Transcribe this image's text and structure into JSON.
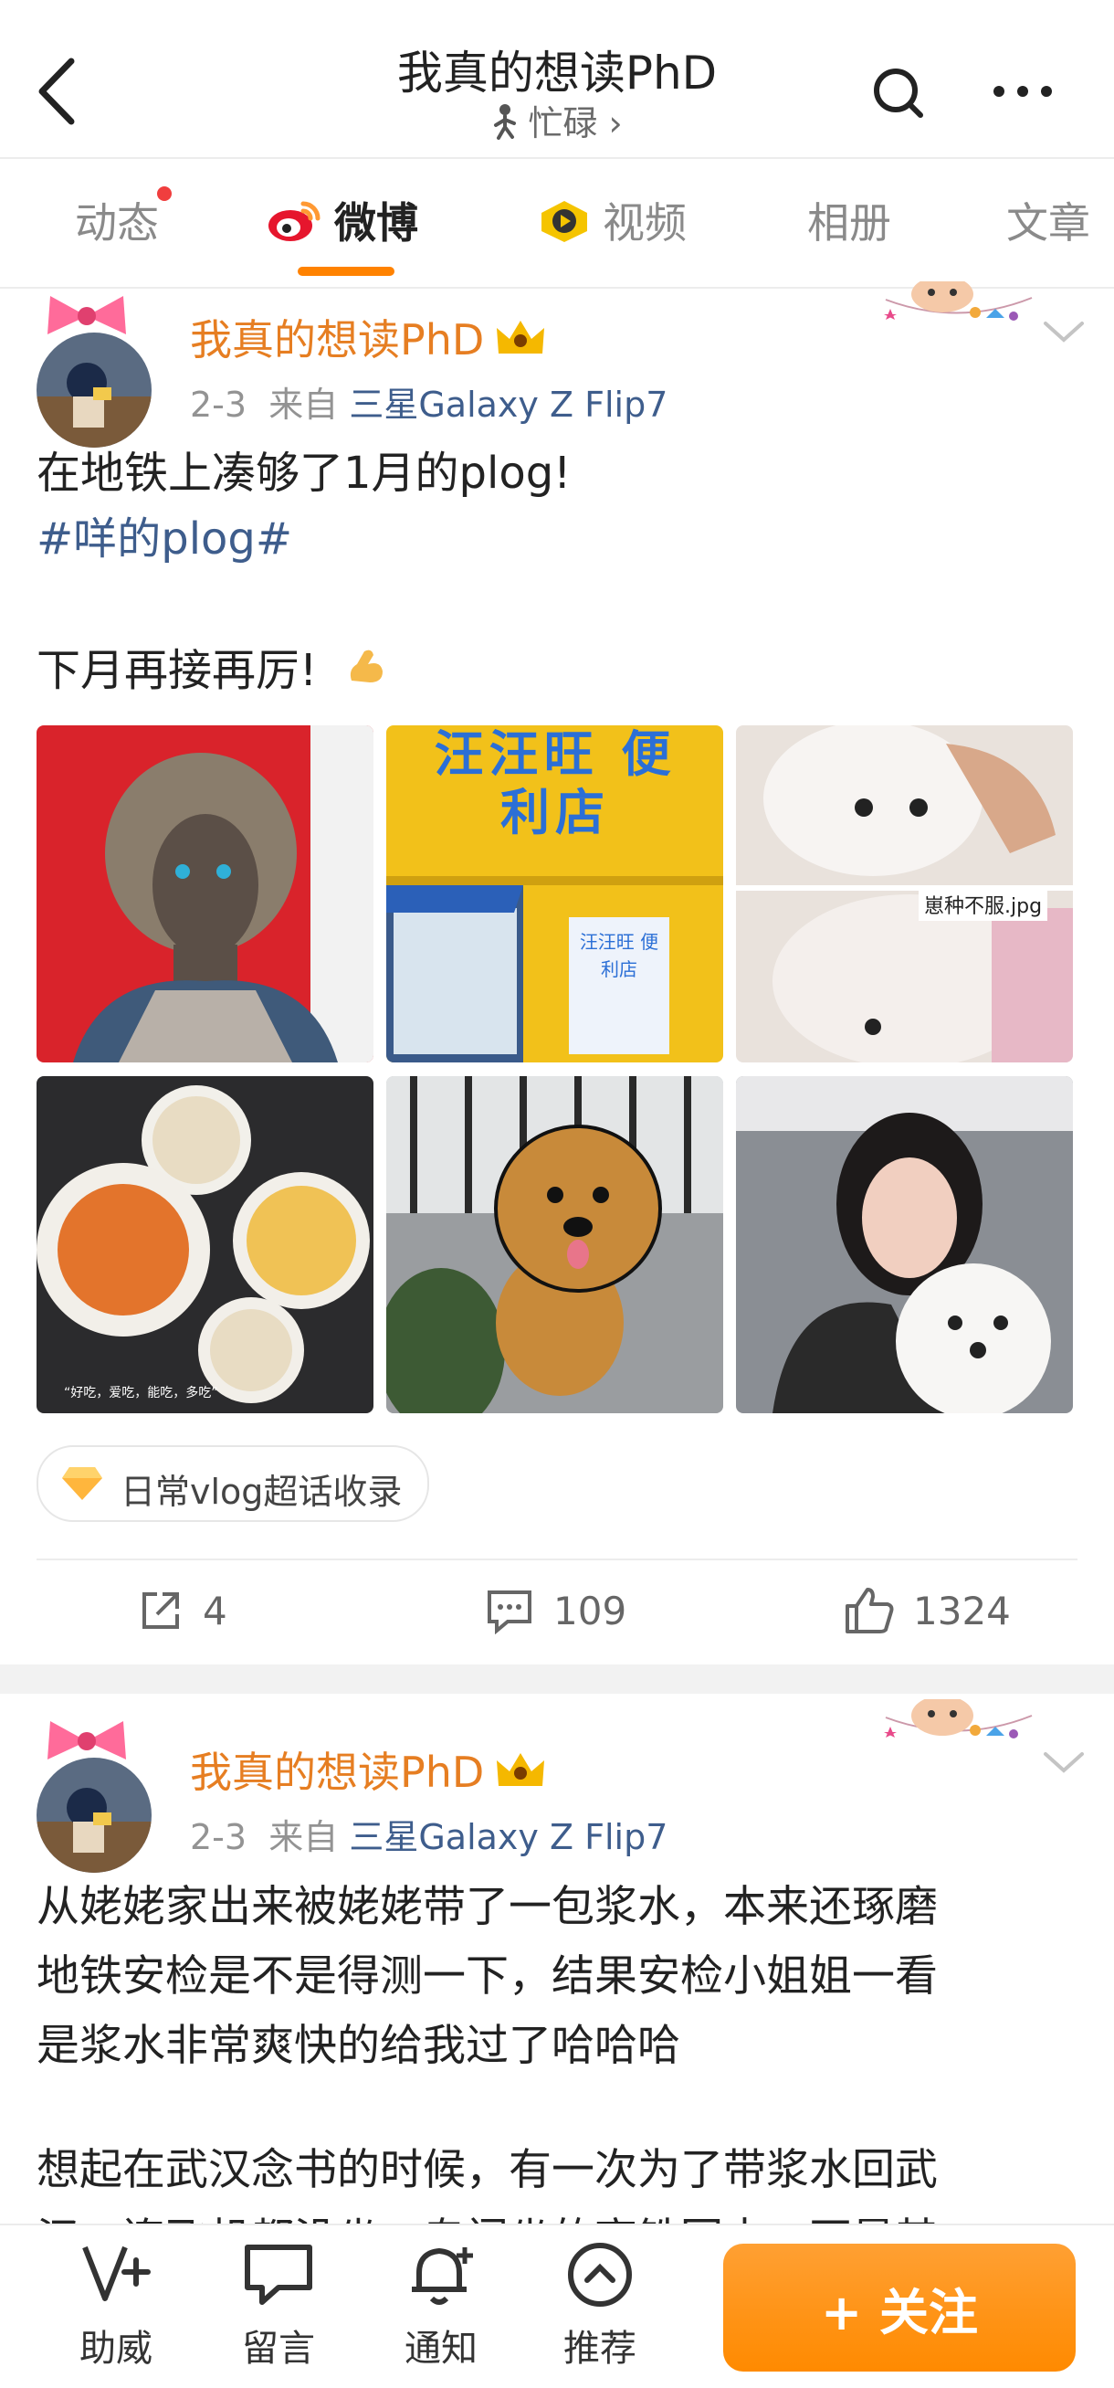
{
  "header": {
    "title": "我真的想读PhD",
    "subtitle": "忙碌 ›",
    "subtitle_icon": "runner-icon"
  },
  "tabs": [
    {
      "label": "动态",
      "has_dot": true
    },
    {
      "label": "微博",
      "active": true
    },
    {
      "label": "视频"
    },
    {
      "label": "相册"
    },
    {
      "label": "文章"
    }
  ],
  "posts": [
    {
      "username": "我真的想读PhD",
      "date": "2-3",
      "from_label": "来自",
      "source": "三星Galaxy Z Flip7",
      "text_line1": "在地铁上凑够了1月的plog!",
      "hashtag": "#咩的plog#",
      "text_line3": "下月再接再厉!",
      "emoji": "flexed-biceps-emoji",
      "image_captions": {
        "store_sign": "汪汪旺 便利店",
        "store_small_sign": "汪汪旺 便利店",
        "dog_caption": "崽种不服.jpg",
        "food_caption": "“好吃，爱吃，能吃，多吃”"
      },
      "super_topic": "日常vlog超话收录",
      "reposts": "4",
      "comments": "109",
      "likes": "1324"
    },
    {
      "username": "我真的想读PhD",
      "date": "2-3",
      "from_label": "来自",
      "source": "三星Galaxy Z Flip7",
      "p1_l1": "从姥姥家出来被姥姥带了一包浆水，本来还琢磨",
      "p1_l2": "地铁安检是不是得测一下，结果安检小姐姐一看",
      "p1_l3": "是浆水非常爽快的给我过了哈哈哈",
      "p2_l1": "想起在武汉念书的时候，有一次为了带浆水回武",
      "p2_l2": "汉，连飞机都没坐，专门坐的高铁回去，不是其"
    }
  ],
  "bottom_bar": {
    "items": [
      {
        "label": "助威",
        "icon": "v-plus-icon"
      },
      {
        "label": "留言",
        "icon": "message-icon"
      },
      {
        "label": "通知",
        "icon": "bell-plus-icon"
      },
      {
        "label": "推荐",
        "icon": "chevron-up-circle-icon"
      }
    ],
    "follow_label": "+ 关注"
  },
  "colors": {
    "accent": "#ff8200",
    "username": "#e67e22",
    "link": "#3e5d8c",
    "notification_dot": "#f03e3e"
  }
}
